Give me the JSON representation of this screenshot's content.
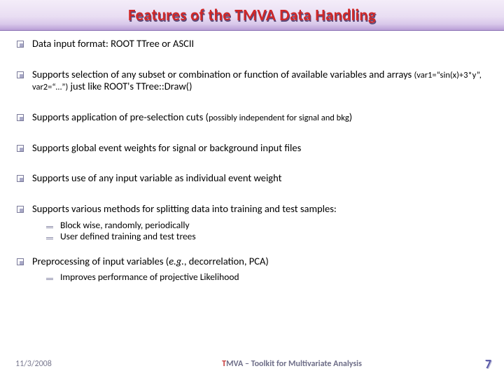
{
  "title": "Features of the TMVA Data Handling",
  "bullets": {
    "b1": "Data input format: ROOT TTree or ASCII",
    "b2a": "Supports selection of any subset or combination or function of available variables and arrays ",
    "b2b": "(var1=“sin(x)+3*y”, var2=“…”)",
    "b2c": " just like ROOT's TTree::Draw()",
    "b3a": "Supports application of pre-selection cuts (",
    "b3b": "possibly independent for signal and bkg",
    "b3c": ")",
    "b4": "Supports global event weights for signal or background input files",
    "b5": "Supports use of any input variable as individual event weight",
    "b6": "Supports various methods for splitting data into training and test samples:",
    "b6s1": "Block wise, randomly, periodically",
    "b6s2": "User defined training and test trees",
    "b7a": "Preprocessing of input variables (",
    "b7b": "e.g.",
    "b7c": ", decorrelation, PCA)",
    "b7s1": "Improves performance of projective Likelihood"
  },
  "footer": {
    "date": "11/3/2008",
    "center_T": "T",
    "center_rest": "MVA – Toolkit for Multivariate Analysis",
    "page": "7"
  }
}
